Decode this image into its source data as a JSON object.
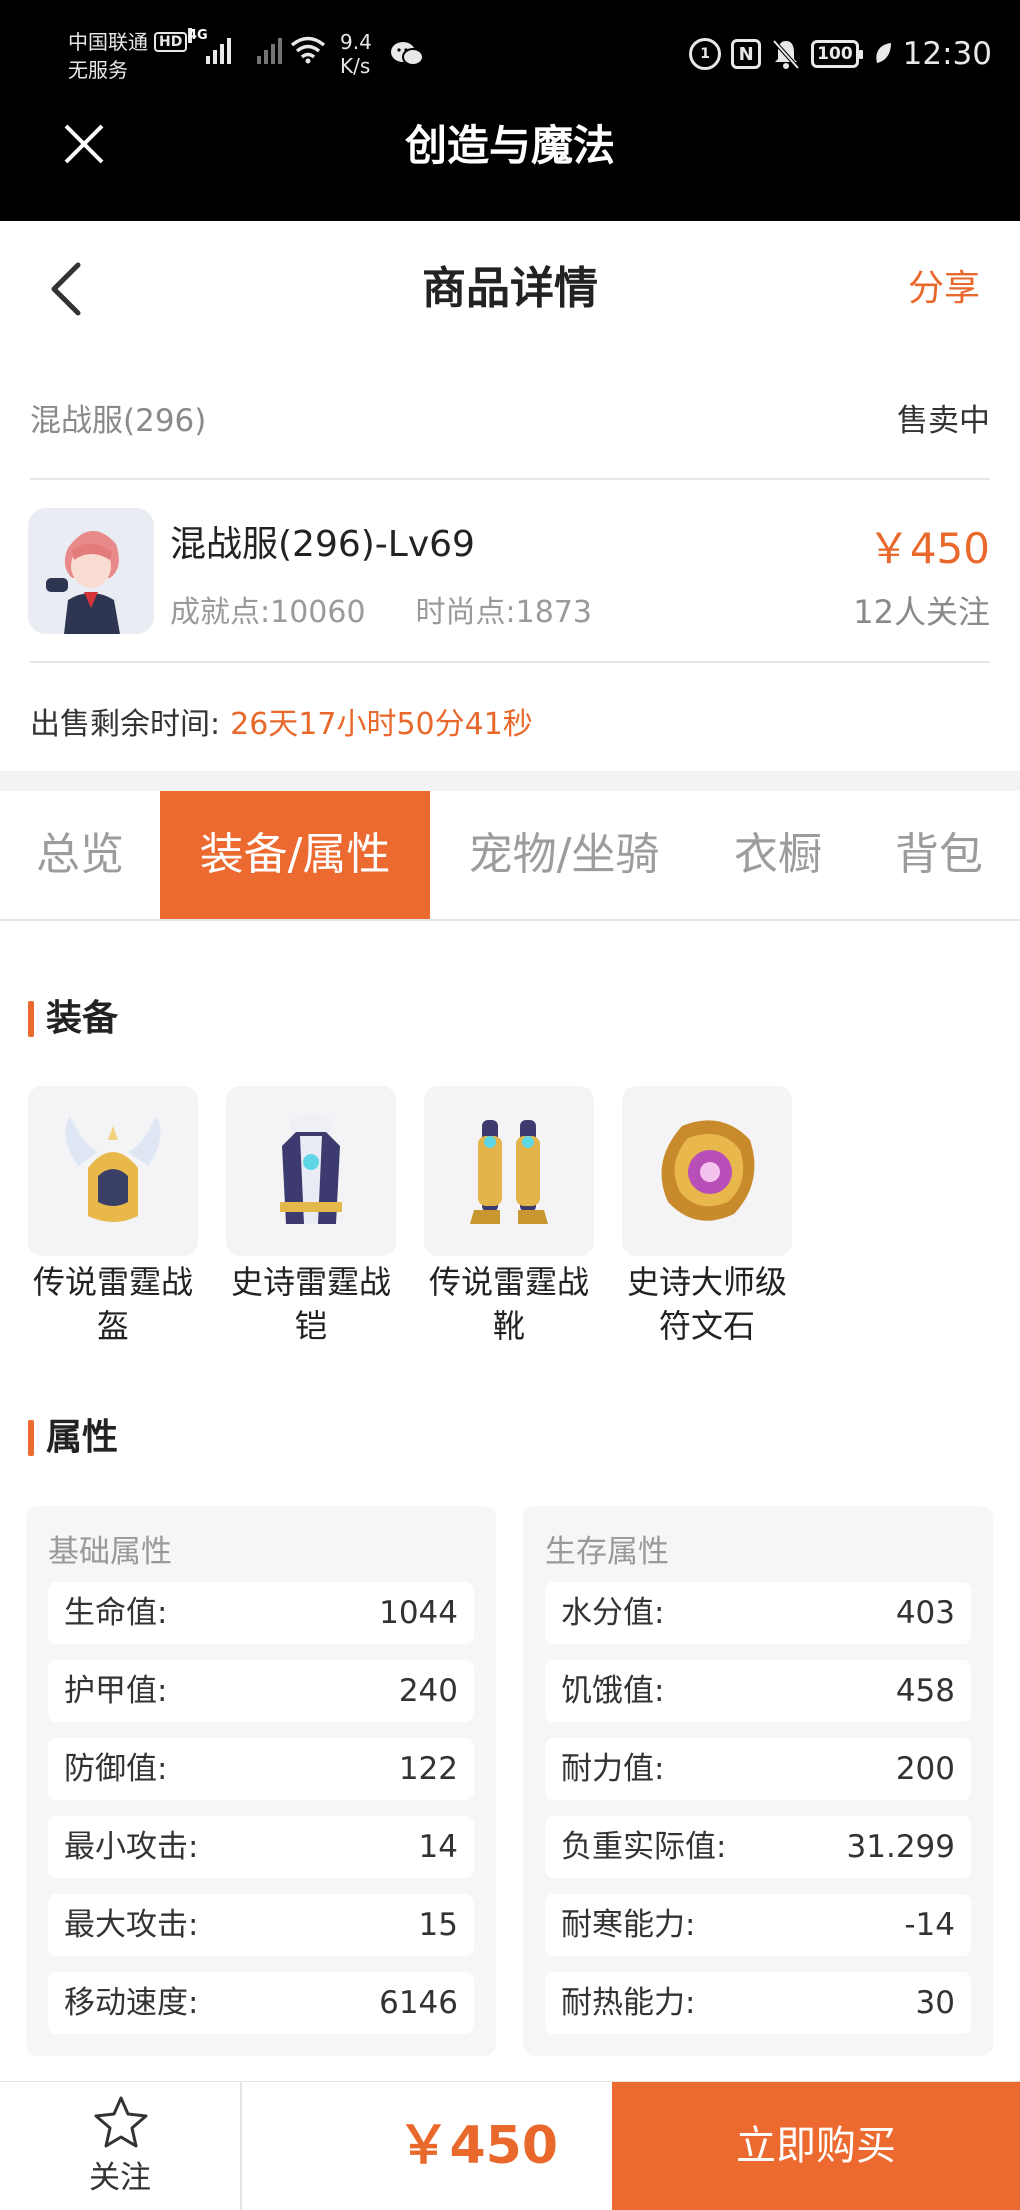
{
  "status_bar": {
    "carrier": "中国联通",
    "hd": "HD",
    "service": "无服务",
    "net_type": "4G",
    "speed_value": "9.4",
    "speed_unit": "K/s",
    "battery": "100",
    "time": "12:30"
  },
  "app": {
    "title": "创造与魔法"
  },
  "nav": {
    "title": "商品详情",
    "share": "分享"
  },
  "product": {
    "server": "混战服(296)",
    "status": "售卖中",
    "name": "混战服(296)-Lv69",
    "achievement": "成就点:10060",
    "fashion": "时尚点:1873",
    "price": "￥450",
    "followers": "12人关注",
    "remain_label": "出售剩余时间:",
    "remain_value": "26天17小时50分41秒"
  },
  "tabs": [
    {
      "label": "总览",
      "active": false
    },
    {
      "label": "装备/属性",
      "active": true
    },
    {
      "label": "宠物/坐骑",
      "active": false
    },
    {
      "label": "衣橱",
      "active": false
    },
    {
      "label": "背包",
      "active": false
    }
  ],
  "equipment": {
    "title": "装备",
    "items": [
      {
        "label_line1": "传说雷霆战",
        "label_line2": "盔"
      },
      {
        "label_line1": "史诗雷霆战",
        "label_line2": "铠"
      },
      {
        "label_line1": "传说雷霆战",
        "label_line2": "靴"
      },
      {
        "label_line1": "史诗大师级",
        "label_line2": "符文石"
      }
    ]
  },
  "attributes": {
    "title": "属性",
    "basic": {
      "header": "基础属性",
      "rows": [
        {
          "key": "生命值:",
          "value": "1044"
        },
        {
          "key": "护甲值:",
          "value": "240"
        },
        {
          "key": "防御值:",
          "value": "122"
        },
        {
          "key": "最小攻击:",
          "value": "14"
        },
        {
          "key": "最大攻击:",
          "value": "15"
        },
        {
          "key": "移动速度:",
          "value": "6146"
        }
      ]
    },
    "survival": {
      "header": "生存属性",
      "rows": [
        {
          "key": "水分值:",
          "value": "403"
        },
        {
          "key": "饥饿值:",
          "value": "458"
        },
        {
          "key": "耐力值:",
          "value": "200"
        },
        {
          "key": "负重实际值:",
          "value": "31.299"
        },
        {
          "key": "耐寒能力:",
          "value": "-14"
        },
        {
          "key": "耐热能力:",
          "value": "30"
        }
      ]
    }
  },
  "bottom": {
    "follow": "关注",
    "price": "￥450",
    "buy": "立即购买"
  },
  "colors": {
    "accent": "#ec6a2f",
    "price": "#e9692c"
  }
}
